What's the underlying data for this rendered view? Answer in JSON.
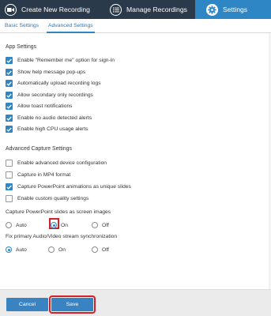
{
  "header": {
    "tabs": [
      {
        "label": "Create New Recording",
        "icon": "video-camera-icon"
      },
      {
        "label": "Manage Recordings",
        "icon": "list-icon"
      },
      {
        "label": "Settings",
        "icon": "gear-icon",
        "active": true
      }
    ]
  },
  "subtabs": {
    "basic": "Basic Settings",
    "advanced": "Advanced Settings",
    "active": "Advanced Settings"
  },
  "app_settings": {
    "title": "App Settings",
    "items": [
      {
        "label": "Enable \"Remember me\" option for sign-in",
        "checked": true
      },
      {
        "label": "Show help message pop-ups",
        "checked": true
      },
      {
        "label": "Automatically upload recording logs",
        "checked": true
      },
      {
        "label": "Allow secondary only recordings",
        "checked": true
      },
      {
        "label": "Allow toast notifications",
        "checked": true
      },
      {
        "label": "Enable no audio detected alerts",
        "checked": true
      },
      {
        "label": "Enable high CPU usage alerts",
        "checked": true
      }
    ]
  },
  "capture_settings": {
    "title": "Advanced Capture Settings",
    "items": [
      {
        "label": "Enable advanced device configuration",
        "checked": false
      },
      {
        "label": "Capture in MP4 format",
        "checked": false
      },
      {
        "label": "Capture PowerPoint animations as unique slides",
        "checked": true
      },
      {
        "label": "Enable custom quality settings",
        "checked": false
      }
    ]
  },
  "ppt_images": {
    "label": "Capture PowerPoint slides as screen images",
    "options": [
      "Auto",
      "On",
      "Off"
    ],
    "selected": "On"
  },
  "av_sync": {
    "label": "Fix primary Audio/Video stream synchronization",
    "options": [
      "Auto",
      "On",
      "Off"
    ],
    "selected": "Auto"
  },
  "footer": {
    "cancel": "Cancel",
    "save": "Save"
  },
  "colors": {
    "topbar": "#2b3a4a",
    "accent": "#2f86c5",
    "highlight": "#d0202a"
  }
}
